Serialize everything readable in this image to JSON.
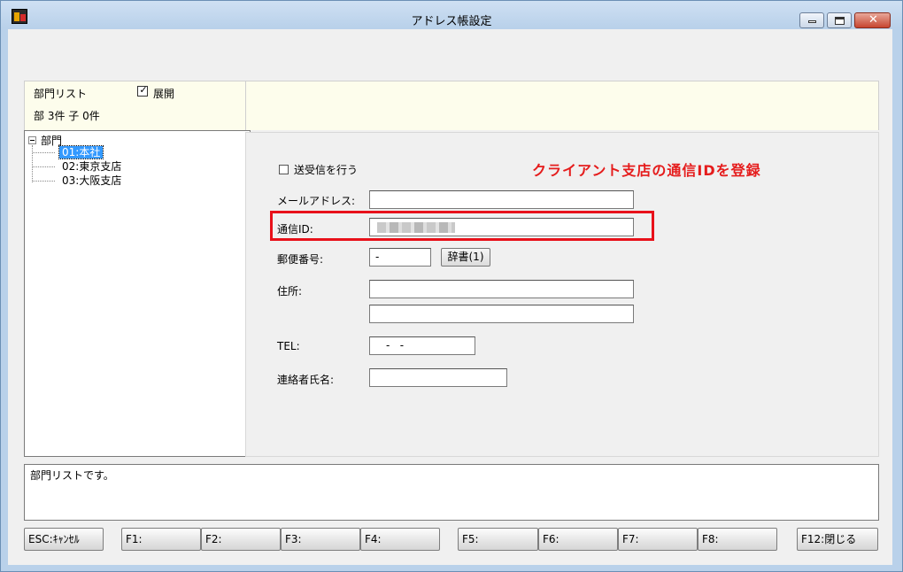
{
  "window": {
    "title": "アドレス帳設定",
    "close_glyph": "✕"
  },
  "left_panel": {
    "dept_list_label": "部門リスト",
    "expand_label": "展開",
    "expand_checked": true,
    "count_text": "部 3件 子 0件",
    "tree": {
      "root_label": "部門",
      "expander_state": "expanded",
      "nodes": [
        {
          "label": "01:本社",
          "selected": true
        },
        {
          "label": "02:東京支店",
          "selected": false
        },
        {
          "label": "03:大阪支店",
          "selected": false
        }
      ]
    }
  },
  "form": {
    "send_receive_label": "送受信を行う",
    "send_receive_checked": false,
    "annotation": "クライアント支店の通信IDを登録",
    "annotation_color": "#e51c1c",
    "email_label": "メールアドレス:",
    "email_value": "",
    "comm_id_label": "通信ID:",
    "postal_label": "郵便番号:",
    "postal_value": "-",
    "dictionary_button": "辞書(1)",
    "address_label": "住所:",
    "address_line1": "",
    "address_line2": "",
    "tel_label": "TEL:",
    "tel_value": "-   -",
    "contact_label": "連絡者氏名:",
    "contact_value": ""
  },
  "message": "部門リストです。",
  "function_keys": [
    {
      "id": "esc",
      "label": "ESC:ｷｬﾝｾﾙ"
    },
    {
      "id": "f1",
      "label": "F1:"
    },
    {
      "id": "f2",
      "label": "F2:"
    },
    {
      "id": "f3",
      "label": "F3:"
    },
    {
      "id": "f4",
      "label": "F4:"
    },
    {
      "id": "f5",
      "label": "F5:"
    },
    {
      "id": "f6",
      "label": "F6:"
    },
    {
      "id": "f7",
      "label": "F7:"
    },
    {
      "id": "f8",
      "label": "F8:"
    },
    {
      "id": "f12",
      "label": "F12:閉じる"
    }
  ]
}
